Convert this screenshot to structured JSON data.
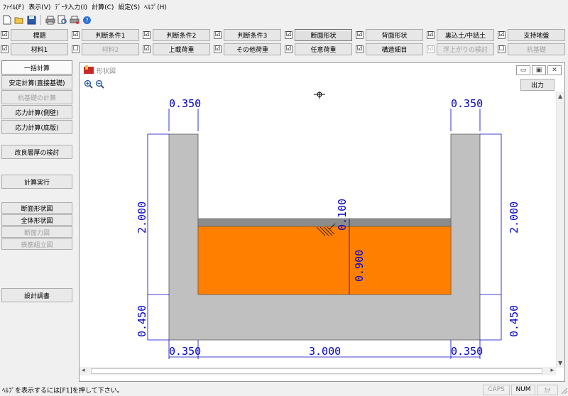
{
  "menu": [
    "ﾌｧｲﾙ(F)",
    "表示(V)",
    "ﾃﾞｰﾀ入力(I)",
    "計算(C)",
    "設定(S)",
    "ﾍﾙﾌﾟ(H)"
  ],
  "conditions": {
    "row1": [
      {
        "checked": "☑",
        "label": "標題"
      },
      {
        "checked": "☑",
        "label": "判断条件1"
      },
      {
        "checked": "☑",
        "label": "判断条件2"
      },
      {
        "checked": "☑",
        "label": "判断条件3"
      },
      {
        "checked": "☑",
        "label": "断面形状"
      },
      {
        "checked": "☑",
        "label": "背面形状"
      },
      {
        "checked": "☑",
        "label": "裏込土/中詰土"
      },
      {
        "checked": "☑",
        "label": "支持地盤"
      }
    ],
    "row2": [
      {
        "checked": "☑",
        "label": "材料1"
      },
      {
        "checked": "☐",
        "label": "材料2"
      },
      {
        "checked": "☑",
        "label": "上載荷重"
      },
      {
        "checked": "☑",
        "label": "その他荷重"
      },
      {
        "checked": "☑",
        "label": "任意荷重"
      },
      {
        "checked": "☑",
        "label": "構造細目"
      },
      {
        "checked": "☑",
        "label": "浮上がりの検討"
      },
      {
        "checked": "☐",
        "label": "杭基礎"
      }
    ]
  },
  "left_panel": {
    "batch_calc": "一括計算",
    "stability_calc": "安定計算(直接基礎)",
    "pile_calc": "杭基礎の計算",
    "stress_wall": "応力計算(側壁)",
    "stress_base": "応力計算(底版)",
    "improve_layer": "改良層厚の検討",
    "run_calc": "計算実行",
    "section_view": "断面形状図",
    "full_view": "全体形状図",
    "force_view": "断面力図",
    "rebar_view": "鉄筋組立図",
    "design_report": "設計調書"
  },
  "window": {
    "title": "形状図",
    "output_label": "出力",
    "minimize": "▭",
    "maximize": "▣",
    "close": "✕"
  },
  "drawing": {
    "top_left_width": "0.350",
    "top_right_width": "0.350",
    "left_height": "2.000",
    "right_height": "2.000",
    "left_base": "0.450",
    "right_base": "0.450",
    "bottom_left": "0.350",
    "bottom_mid": "3.000",
    "bottom_right": "0.350",
    "pavement_thickness": "0.100",
    "fill_height": "0.900",
    "colors": {
      "concrete": "#c0c0c0",
      "fill": "#ff8000",
      "pavement": "#8c8c8c",
      "dimension": "#0000cc"
    }
  },
  "status": {
    "help_text": "ﾍﾙﾌﾟを表示するには[F1]を押して下さい。",
    "caps": "CAPS",
    "num": "NUM",
    "kana": "ｶﾅ"
  }
}
